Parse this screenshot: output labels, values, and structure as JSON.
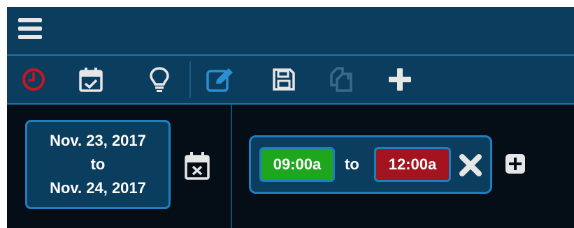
{
  "header": {
    "menu_icon": "hamburger-menu-icon"
  },
  "toolbar": {
    "items": [
      {
        "name": "clock",
        "icon": "clock-icon",
        "color": "#c8161e"
      },
      {
        "name": "calendar-check",
        "icon": "calendar-check-icon",
        "color": "#e6e6e6"
      },
      {
        "name": "lightbulb",
        "icon": "lightbulb-icon",
        "color": "#e6e6e6"
      },
      {
        "name": "edit",
        "icon": "edit-icon",
        "color": "#2b8fd0"
      },
      {
        "name": "save",
        "icon": "save-icon",
        "color": "#e6e6e6"
      },
      {
        "name": "copy",
        "icon": "copy-icon",
        "color": "#3a6a8a"
      },
      {
        "name": "add",
        "icon": "plus-icon",
        "color": "#e6e6e6"
      }
    ]
  },
  "date_range": {
    "start": "Nov. 23, 2017",
    "separator": "to",
    "end": "Nov. 24, 2017"
  },
  "time_range": {
    "start": "09:00a",
    "separator": "to",
    "end": "12:00a",
    "start_color": "#1ea71e",
    "end_color": "#a3141e"
  },
  "colors": {
    "bar_background": "#0a3d5e",
    "accent_border": "#1e7fc0",
    "content_background": "#050d16"
  }
}
